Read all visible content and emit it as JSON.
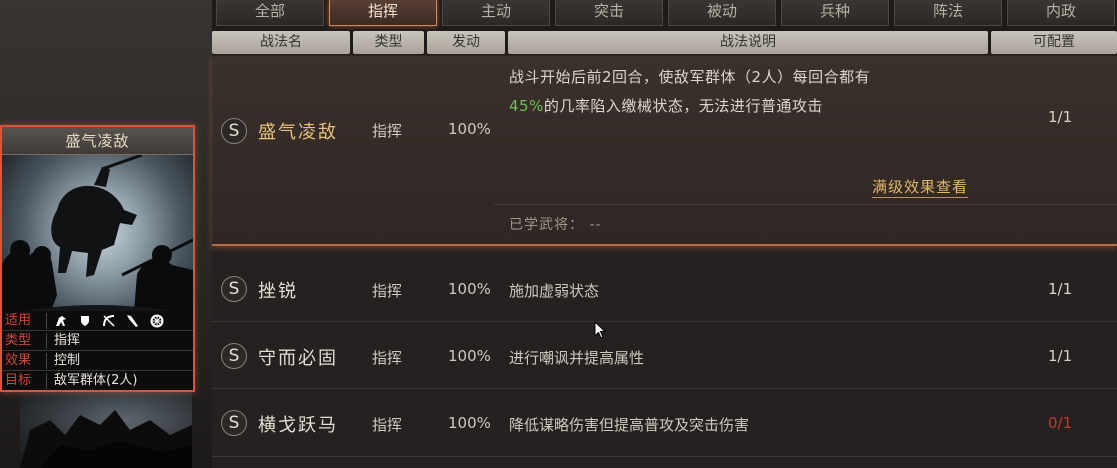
{
  "tabs": [
    {
      "label": "全部",
      "active": false
    },
    {
      "label": "指挥",
      "active": true
    },
    {
      "label": "主动",
      "active": false
    },
    {
      "label": "突击",
      "active": false
    },
    {
      "label": "被动",
      "active": false
    },
    {
      "label": "兵种",
      "active": false
    },
    {
      "label": "阵法",
      "active": false
    },
    {
      "label": "内政",
      "active": false
    }
  ],
  "columns": {
    "name": "战法名",
    "type": "类型",
    "rate": "发动",
    "desc": "战法说明",
    "slot": "可配置"
  },
  "card": {
    "title": "盛气凌敌",
    "rows": [
      {
        "key": "适用",
        "icons": [
          "cavalry-icon",
          "shield-icon",
          "bow-icon",
          "spear-icon",
          "chariot-icon"
        ]
      },
      {
        "key": "类型",
        "value": "指挥"
      },
      {
        "key": "效果",
        "value": "控制"
      },
      {
        "key": "目标",
        "value": "敌军群体(2人)"
      }
    ]
  },
  "expanded_skill": {
    "badge": "S",
    "name": "盛气凌敌",
    "type": "指挥",
    "rate": "100%",
    "desc_line1": "战斗开始后前2回合，使敌军群体（2人）每回合都有",
    "desc_line2_highlight": "45%",
    "desc_line2_rest": "的几率陷入缴械状态，无法进行普通攻击",
    "slot": "1/1",
    "full_effect_link": "满级效果查看",
    "learned_label": "已学武将：",
    "learned_value": "--"
  },
  "skills": [
    {
      "badge": "S",
      "name": "挫锐",
      "type": "指挥",
      "rate": "100%",
      "desc": "施加虚弱状态",
      "slot": "1/1",
      "slot_color": "#d8d2c8"
    },
    {
      "badge": "S",
      "name": "守而必固",
      "type": "指挥",
      "rate": "100%",
      "desc": "进行嘲讽并提高属性",
      "slot": "1/1",
      "slot_color": "#d8d2c8"
    },
    {
      "badge": "S",
      "name": "横戈跃马",
      "type": "指挥",
      "rate": "100%",
      "desc": "降低谋略伤害但提高普攻及突击伤害",
      "slot": "0/1",
      "slot_color": "#c23b2e"
    }
  ],
  "colors": {
    "accent_gold": "#e6c27a",
    "highlight_green": "#6fbf5a",
    "card_border": "#d7573e",
    "warning_red": "#c23b2e"
  }
}
